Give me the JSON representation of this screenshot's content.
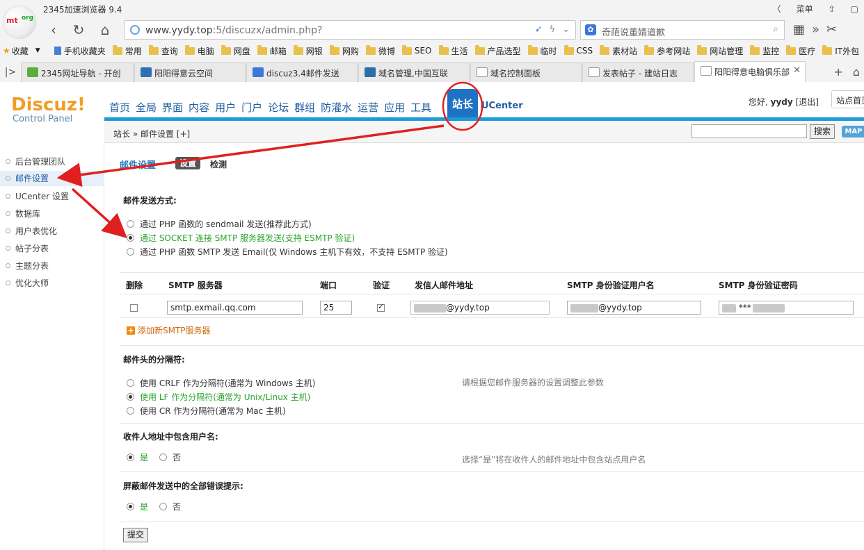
{
  "browser": {
    "window_title": "2345加速浏览器 9.4",
    "title_controls": [
      "〈",
      "菜单",
      "⇧",
      "▢"
    ],
    "logo_text": "mt",
    "logo_sub": "org",
    "url_host": "www.yydy.top",
    "url_rest": ":5/discuzx/admin.php?",
    "search_text": "奇葩说董婧道歉",
    "bookmarks": [
      {
        "label": "收藏",
        "icon": "star"
      },
      {
        "label": "手机收藏夹",
        "icon": "page"
      },
      {
        "label": "常用",
        "icon": "folder"
      },
      {
        "label": "查询",
        "icon": "folder"
      },
      {
        "label": "电脑",
        "icon": "folder"
      },
      {
        "label": "网盘",
        "icon": "folder"
      },
      {
        "label": "邮箱",
        "icon": "folder"
      },
      {
        "label": "网银",
        "icon": "folder"
      },
      {
        "label": "网购",
        "icon": "folder"
      },
      {
        "label": "微博",
        "icon": "folder"
      },
      {
        "label": "SEO",
        "icon": "folder"
      },
      {
        "label": "生活",
        "icon": "folder"
      },
      {
        "label": "产品选型",
        "icon": "folder"
      },
      {
        "label": "临时",
        "icon": "folder"
      },
      {
        "label": "CSS",
        "icon": "folder"
      },
      {
        "label": "素材站",
        "icon": "folder"
      },
      {
        "label": "参考网站",
        "icon": "folder"
      },
      {
        "label": "网站管理",
        "icon": "folder"
      },
      {
        "label": "监控",
        "icon": "folder"
      },
      {
        "label": "医疗",
        "icon": "folder"
      },
      {
        "label": "IT外包",
        "icon": "folder"
      }
    ],
    "tabs": [
      {
        "label": "2345网址导航 - 开创",
        "color": "#5cae3c",
        "active": false
      },
      {
        "label": "阳阳得意云空间",
        "color": "#2f6fb5",
        "active": false
      },
      {
        "label": "discuz3.4邮件发送",
        "color": "#3c78d8",
        "active": false
      },
      {
        "label": "域名管理,中国互联",
        "color": "#2b6ea8",
        "active": false
      },
      {
        "label": "域名控制面板",
        "color": "#999999",
        "active": false
      },
      {
        "label": "发表帖子 - 建站日志",
        "color": "#999999",
        "active": false
      },
      {
        "label": "阳阳得意电脑俱乐部",
        "color": "#999999",
        "active": true
      }
    ]
  },
  "discuz": {
    "logo": "Discuz!",
    "logo_sub": "Control Panel",
    "nav": [
      "首页",
      "全局",
      "界面",
      "内容",
      "用户",
      "门户",
      "论坛",
      "群组",
      "防灌水",
      "运营",
      "应用",
      "工具"
    ],
    "nav_active": "站长",
    "nav_uc": "UCenter",
    "greeting_prefix": "您好,",
    "username": "yydy",
    "logout": "[退出]",
    "site_home": "站点首页",
    "crumb": "站长 » 邮件设置  [+]",
    "search_btn": "搜索",
    "map_btn": "MAP",
    "sidebar": [
      "后台管理团队",
      "邮件设置",
      "UCenter 设置",
      "数据库",
      "用户表优化",
      "帖子分表",
      "主题分表",
      "优化大师"
    ],
    "sidebar_active": 1,
    "sub_title": "邮件设置",
    "sub_tab_set": "设置",
    "sub_tab_check": "检测",
    "send_mode": {
      "title": "邮件发送方式:",
      "options": [
        "通过 PHP 函数的 sendmail 发送(推荐此方式)",
        "通过 SOCKET 连接 SMTP 服务器发送(支持 ESMTP 验证)",
        "通过 PHP 函数 SMTP 发送 Email(仅 Windows 主机下有效，不支持 ESMTP 验证)"
      ],
      "selected": 1
    },
    "smtp_table": {
      "headers": [
        "删除",
        "SMTP 服务器",
        "端口",
        "验证",
        "发信人邮件地址",
        "SMTP 身份验证用户名",
        "SMTP 身份验证密码"
      ],
      "row": {
        "server": "smtp.exmail.qq.com",
        "port": "25",
        "auth": true,
        "from": "@yydy.top",
        "user": "@yydy.top",
        "password": "***"
      }
    },
    "add_smtp": "添加新SMTP服务器",
    "delimiter": {
      "title": "邮件头的分隔符:",
      "options": [
        "使用 CRLF 作为分隔符(通常为 Windows 主机)",
        "使用 LF 作为分隔符(通常为 Unix/Linux 主机)",
        "使用 CR 作为分隔符(通常为 Mac 主机)"
      ],
      "selected": 1,
      "hint": "请根据您邮件服务器的设置调整此参数"
    },
    "include_user": {
      "title": "收件人地址中包含用户名:",
      "yes": "是",
      "no": "否",
      "selected": "yes",
      "hint": "选择“是”将在收件人的邮件地址中包含站点用户名"
    },
    "silent": {
      "title": "屏蔽邮件发送中的全部错误提示:",
      "yes": "是",
      "no": "否",
      "selected": "yes"
    },
    "submit": "提交"
  },
  "colors": {
    "accent_blue": "#1e72c3",
    "annotation_red": "#e02020",
    "selected_green": "#2aa52a"
  }
}
